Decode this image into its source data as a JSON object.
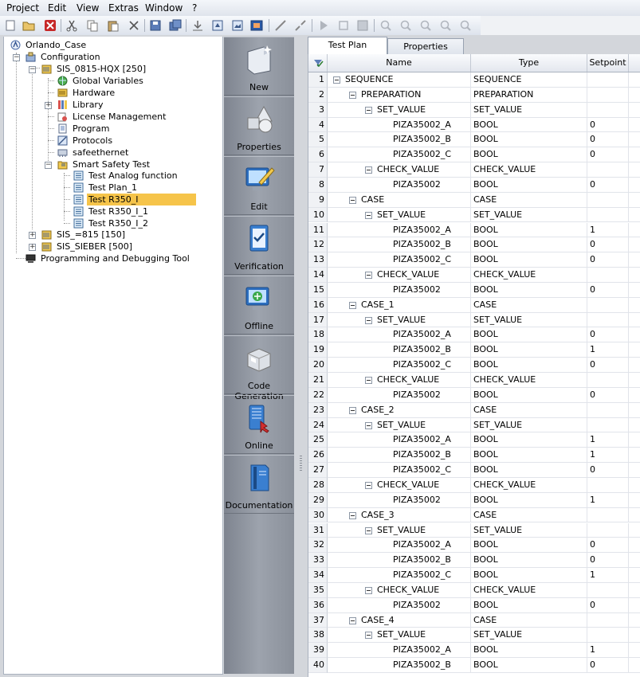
{
  "menu": [
    "Project",
    "Edit",
    "View",
    "Extras",
    "Window",
    "?"
  ],
  "toolbar_icons": [
    "new-icon",
    "open-icon",
    "delete-icon",
    "cut-icon",
    "copy-icon",
    "paste-icon",
    "close-x-icon",
    "save-icon",
    "save-all-icon",
    "import-icon",
    "export-icon",
    "image-icon",
    "screen-icon",
    "plug-icon",
    "unplug-icon",
    "play-icon",
    "stop-icon",
    "step-icon",
    "zoom-in-icon",
    "zoom-out-icon",
    "zoom-fit-icon",
    "zoom-page-icon",
    "zoom-reset-icon"
  ],
  "tree": [
    {
      "label": "Orlando_Case",
      "icon": "project-icon"
    },
    {
      "label": "Configuration",
      "icon": "configuration-icon"
    },
    {
      "label": "SIS_0815-HQX [250]",
      "icon": "resource-icon"
    },
    {
      "label": "Global Variables",
      "icon": "globe-icon"
    },
    {
      "label": "Hardware",
      "icon": "hardware-icon"
    },
    {
      "label": "Library",
      "icon": "library-icon"
    },
    {
      "label": "License Management",
      "icon": "license-icon"
    },
    {
      "label": "Program",
      "icon": "program-icon"
    },
    {
      "label": "Protocols",
      "icon": "protocols-icon"
    },
    {
      "label": "safeethernet",
      "icon": "network-icon"
    },
    {
      "label": "Smart Safety Test",
      "icon": "test-folder-icon"
    },
    {
      "label": "Test Analog function",
      "icon": "test-plan-icon"
    },
    {
      "label": "Test Plan_1",
      "icon": "test-plan-icon"
    },
    {
      "label": "Test R350_I",
      "icon": "test-plan-icon"
    },
    {
      "label": "Test R350_I_1",
      "icon": "test-plan-icon"
    },
    {
      "label": "Test R350_I_2",
      "icon": "test-plan-icon"
    },
    {
      "label": "SIS_=815 [150]",
      "icon": "resource-icon"
    },
    {
      "label": "SIS_SIEBER [500]",
      "icon": "resource-icon"
    },
    {
      "label": "Programming and Debugging Tool",
      "icon": "pc-icon"
    }
  ],
  "actions": [
    {
      "label": "New",
      "icon": "new-item-icon"
    },
    {
      "label": "Properties",
      "icon": "properties-icon"
    },
    {
      "label": "Edit",
      "icon": "edit-icon"
    },
    {
      "label": "Verification",
      "icon": "verification-icon"
    },
    {
      "label": "Offline",
      "icon": "offline-icon"
    },
    {
      "label": "Code Generation",
      "icon": "code-generation-icon"
    },
    {
      "label": "Online",
      "icon": "online-icon"
    },
    {
      "label": "Documentation",
      "icon": "documentation-icon"
    }
  ],
  "tabs": [
    "Test Plan",
    "Properties"
  ],
  "columns": {
    "name": "Name",
    "type": "Type",
    "setpoint": "Setpoint"
  },
  "rows": [
    {
      "n": "1",
      "name": "SEQUENCE",
      "type": "SEQUENCE",
      "sp": ""
    },
    {
      "n": "2",
      "name": "PREPARATION",
      "type": "PREPARATION",
      "sp": ""
    },
    {
      "n": "3",
      "name": "SET_VALUE",
      "type": "SET_VALUE",
      "sp": ""
    },
    {
      "n": "4",
      "name": "PIZA35002_A",
      "type": "BOOL",
      "sp": "0"
    },
    {
      "n": "5",
      "name": "PIZA35002_B",
      "type": "BOOL",
      "sp": "0"
    },
    {
      "n": "6",
      "name": "PIZA35002_C",
      "type": "BOOL",
      "sp": "0"
    },
    {
      "n": "7",
      "name": "CHECK_VALUE",
      "type": "CHECK_VALUE",
      "sp": ""
    },
    {
      "n": "8",
      "name": "PIZA35002",
      "type": "BOOL",
      "sp": "0"
    },
    {
      "n": "9",
      "name": "CASE",
      "type": "CASE",
      "sp": ""
    },
    {
      "n": "10",
      "name": "SET_VALUE",
      "type": "SET_VALUE",
      "sp": ""
    },
    {
      "n": "11",
      "name": "PIZA35002_A",
      "type": "BOOL",
      "sp": "1"
    },
    {
      "n": "12",
      "name": "PIZA35002_B",
      "type": "BOOL",
      "sp": "0"
    },
    {
      "n": "13",
      "name": "PIZA35002_C",
      "type": "BOOL",
      "sp": "0"
    },
    {
      "n": "14",
      "name": "CHECK_VALUE",
      "type": "CHECK_VALUE",
      "sp": ""
    },
    {
      "n": "15",
      "name": "PIZA35002",
      "type": "BOOL",
      "sp": "0"
    },
    {
      "n": "16",
      "name": "CASE_1",
      "type": "CASE",
      "sp": ""
    },
    {
      "n": "17",
      "name": "SET_VALUE",
      "type": "SET_VALUE",
      "sp": ""
    },
    {
      "n": "18",
      "name": "PIZA35002_A",
      "type": "BOOL",
      "sp": "0"
    },
    {
      "n": "19",
      "name": "PIZA35002_B",
      "type": "BOOL",
      "sp": "1"
    },
    {
      "n": "20",
      "name": "PIZA35002_C",
      "type": "BOOL",
      "sp": "0"
    },
    {
      "n": "21",
      "name": "CHECK_VALUE",
      "type": "CHECK_VALUE",
      "sp": ""
    },
    {
      "n": "22",
      "name": "PIZA35002",
      "type": "BOOL",
      "sp": "0"
    },
    {
      "n": "23",
      "name": "CASE_2",
      "type": "CASE",
      "sp": ""
    },
    {
      "n": "24",
      "name": "SET_VALUE",
      "type": "SET_VALUE",
      "sp": ""
    },
    {
      "n": "25",
      "name": "PIZA35002_A",
      "type": "BOOL",
      "sp": "1"
    },
    {
      "n": "26",
      "name": "PIZA35002_B",
      "type": "BOOL",
      "sp": "1"
    },
    {
      "n": "27",
      "name": "PIZA35002_C",
      "type": "BOOL",
      "sp": "0"
    },
    {
      "n": "28",
      "name": "CHECK_VALUE",
      "type": "CHECK_VALUE",
      "sp": ""
    },
    {
      "n": "29",
      "name": "PIZA35002",
      "type": "BOOL",
      "sp": "1"
    },
    {
      "n": "30",
      "name": "CASE_3",
      "type": "CASE",
      "sp": ""
    },
    {
      "n": "31",
      "name": "SET_VALUE",
      "type": "SET_VALUE",
      "sp": ""
    },
    {
      "n": "32",
      "name": "PIZA35002_A",
      "type": "BOOL",
      "sp": "0"
    },
    {
      "n": "33",
      "name": "PIZA35002_B",
      "type": "BOOL",
      "sp": "0"
    },
    {
      "n": "34",
      "name": "PIZA35002_C",
      "type": "BOOL",
      "sp": "1"
    },
    {
      "n": "35",
      "name": "CHECK_VALUE",
      "type": "CHECK_VALUE",
      "sp": ""
    },
    {
      "n": "36",
      "name": "PIZA35002",
      "type": "BOOL",
      "sp": "0"
    },
    {
      "n": "37",
      "name": "CASE_4",
      "type": "CASE",
      "sp": ""
    },
    {
      "n": "38",
      "name": "SET_VALUE",
      "type": "SET_VALUE",
      "sp": ""
    },
    {
      "n": "39",
      "name": "PIZA35002_A",
      "type": "BOOL",
      "sp": "1"
    },
    {
      "n": "40",
      "name": "PIZA35002_B",
      "type": "BOOL",
      "sp": "0"
    }
  ],
  "colors": {
    "selection": "#f6c44a",
    "actionbar": "#8f959f"
  }
}
